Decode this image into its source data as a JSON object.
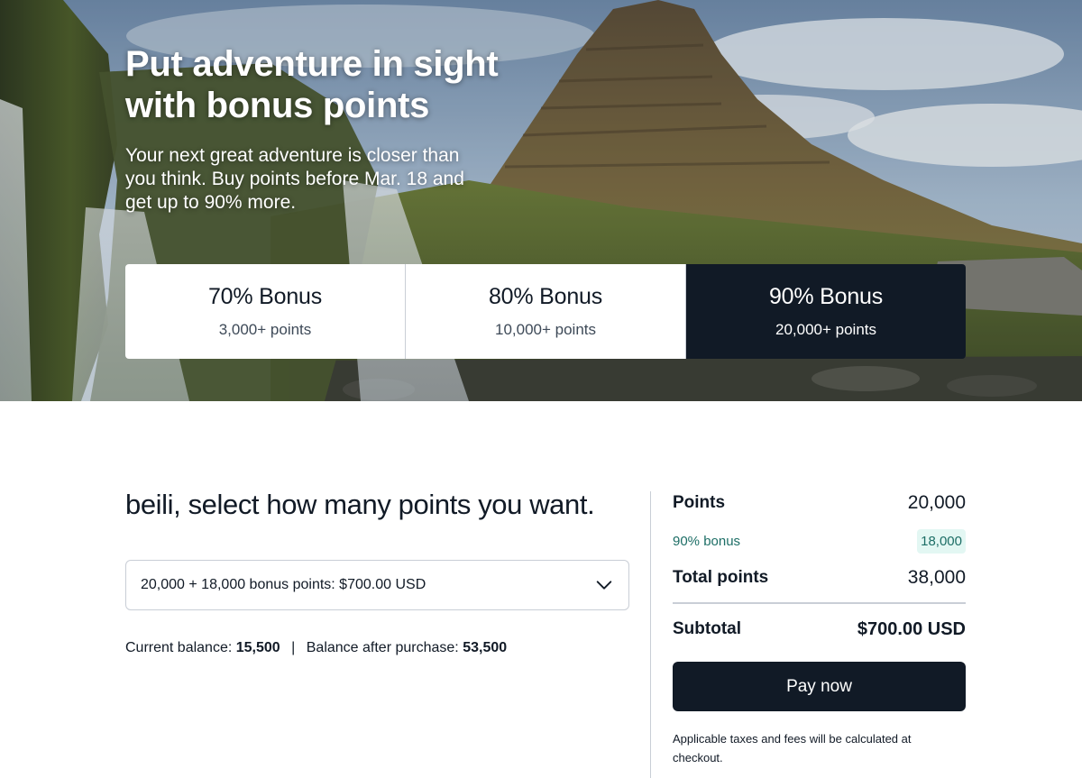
{
  "hero": {
    "title": "Put adventure in sight with bonus points",
    "subtitle": "Your next great adventure is closer than you think. Buy points before Mar. 18 and get up to 90% more.",
    "bonus_options": [
      {
        "title": "70% Bonus",
        "points": "3,000+ points",
        "selected": false
      },
      {
        "title": "80% Bonus",
        "points": "10,000+ points",
        "selected": false
      },
      {
        "title": "90% Bonus",
        "points": "20,000+ points",
        "selected": true
      }
    ]
  },
  "purchase": {
    "heading": "beili, select how many points you want.",
    "select_value": "20,000 + 18,000 bonus points: $700.00 USD",
    "balance": {
      "current_label": "Current balance:",
      "current_value": "15,500",
      "separator": "|",
      "after_label": "Balance after purchase:",
      "after_value": "53,500"
    }
  },
  "summary": {
    "points_label": "Points",
    "points_value": "20,000",
    "bonus_label": "90% bonus",
    "bonus_value": "18,000",
    "total_label": "Total points",
    "total_value": "38,000",
    "subtotal_label": "Subtotal",
    "subtotal_value": "$700.00 USD",
    "pay_label": "Pay now",
    "note": "Applicable taxes and fees will be calculated at checkout."
  },
  "colors": {
    "navy": "#111a26",
    "bonus_teal": "#1d6e66",
    "bonus_bg": "#e3f7f3",
    "border": "#c9ced6"
  },
  "icons": {
    "dropdown": "chevron-down-icon"
  }
}
